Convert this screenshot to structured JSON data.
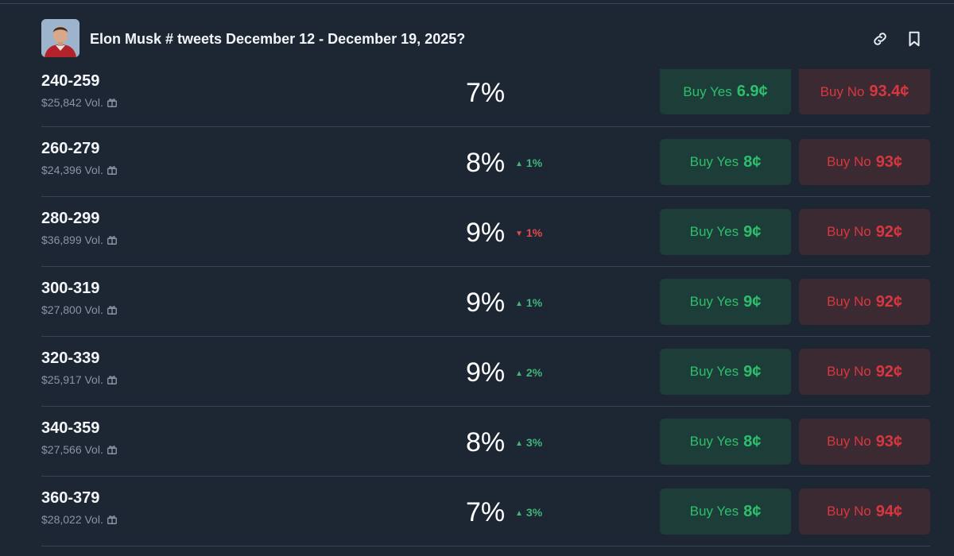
{
  "header": {
    "title": "Elon Musk # tweets December 12 - December 19, 2025?",
    "avatar_icon": "elon-musk-avatar",
    "link_icon": "link-icon",
    "bookmark_icon": "bookmark-icon"
  },
  "colors": {
    "background": "#1d2733",
    "yes_bg": "#1d3d39",
    "yes_text": "#2ebf6d",
    "no_bg": "#3c2a33",
    "no_text": "#d8373f",
    "up": "#3fb67a",
    "down": "#e5484d"
  },
  "buy_yes_label": "Buy Yes",
  "buy_no_label": "Buy No",
  "outcomes": [
    {
      "range": "240-259",
      "volume": "$25,842 Vol.",
      "percent": "7%",
      "change": "",
      "direction": "",
      "yes_price": "6.9¢",
      "no_price": "93.4¢"
    },
    {
      "range": "260-279",
      "volume": "$24,396 Vol.",
      "percent": "8%",
      "change": "1%",
      "direction": "up",
      "yes_price": "8¢",
      "no_price": "93¢"
    },
    {
      "range": "280-299",
      "volume": "$36,899 Vol.",
      "percent": "9%",
      "change": "1%",
      "direction": "down",
      "yes_price": "9¢",
      "no_price": "92¢"
    },
    {
      "range": "300-319",
      "volume": "$27,800 Vol.",
      "percent": "9%",
      "change": "1%",
      "direction": "up",
      "yes_price": "9¢",
      "no_price": "92¢"
    },
    {
      "range": "320-339",
      "volume": "$25,917 Vol.",
      "percent": "9%",
      "change": "2%",
      "direction": "up",
      "yes_price": "9¢",
      "no_price": "92¢"
    },
    {
      "range": "340-359",
      "volume": "$27,566 Vol.",
      "percent": "8%",
      "change": "3%",
      "direction": "up",
      "yes_price": "8¢",
      "no_price": "93¢"
    },
    {
      "range": "360-379",
      "volume": "$28,022 Vol.",
      "percent": "7%",
      "change": "3%",
      "direction": "up",
      "yes_price": "8¢",
      "no_price": "94¢"
    }
  ]
}
